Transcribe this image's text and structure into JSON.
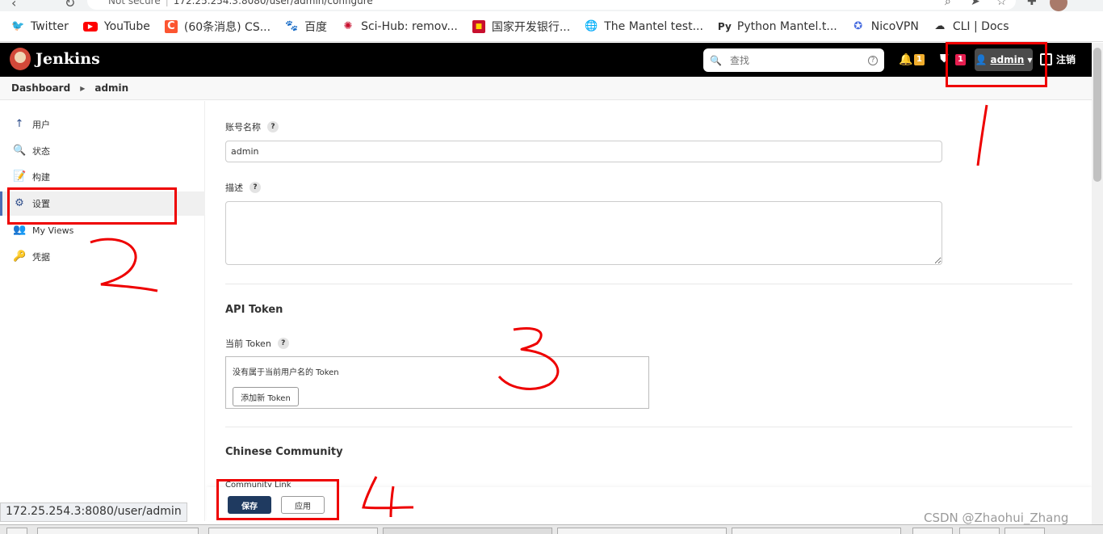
{
  "browser": {
    "security_label": "Not secure",
    "url": "172.25.254.3:8080/user/admin/configure",
    "status_url": "172.25.254.3:8080/user/admin"
  },
  "bookmarks": [
    {
      "label": "Twitter",
      "icon": "twitter-icon",
      "color": "#1da1f2"
    },
    {
      "label": "YouTube",
      "icon": "youtube-icon",
      "color": "#ff0000"
    },
    {
      "label": "(60条消息) CS...",
      "icon": "csdn-icon",
      "color": "#fc5531"
    },
    {
      "label": "百度",
      "icon": "baidu-icon",
      "color": "#2932e1"
    },
    {
      "label": "Sci-Hub: remov...",
      "icon": "scihub-icon",
      "color": "#c8102e"
    },
    {
      "label": "国家开发银行...",
      "icon": "bank-icon",
      "color": "#c8102e"
    },
    {
      "label": "The Mantel test...",
      "icon": "globe-icon",
      "color": "#555555"
    },
    {
      "label": "Python Mantel.t...",
      "icon": "python-icon",
      "color": "#000000"
    },
    {
      "label": "NicoVPN",
      "icon": "vpn-icon",
      "color": "#4a6ee0"
    },
    {
      "label": "CLI | Docs",
      "icon": "cloud-icon",
      "color": "#333333"
    }
  ],
  "header": {
    "brand": "Jenkins",
    "search_placeholder": "查找",
    "notification_count": "1",
    "security_count": "1",
    "user_name": "admin",
    "logout_label": "注销",
    "notify_color": "#f0ad2d",
    "security_color": "#e61e50"
  },
  "breadcrumb": {
    "items": [
      "Dashboard",
      "admin"
    ]
  },
  "sidebar": {
    "items": [
      {
        "label": "用户",
        "icon": "arrow-up-icon"
      },
      {
        "label": "状态",
        "icon": "magnifier-icon"
      },
      {
        "label": "构建",
        "icon": "notepad-icon"
      },
      {
        "label": "设置",
        "icon": "gear-icon"
      },
      {
        "label": "My Views",
        "icon": "people-icon"
      },
      {
        "label": "凭据",
        "icon": "credentials-icon"
      }
    ],
    "active_index": 3
  },
  "form": {
    "account_name_label": "账号名称",
    "account_name_value": "admin",
    "description_label": "描述",
    "description_value": "",
    "api_section_title": "API Token",
    "current_token_label": "当前 Token",
    "no_token_message": "没有属于当前用户名的 Token",
    "add_token_button": "添加新 Token",
    "community_section_title": "Chinese Community",
    "community_link_label": "Community Link",
    "save_button": "保存",
    "apply_button": "应用"
  },
  "annotations": {
    "numbers": [
      "1",
      "2",
      "3",
      "4"
    ],
    "color": "#e00000"
  },
  "watermark": "CSDN @Zhaohui_Zhang"
}
